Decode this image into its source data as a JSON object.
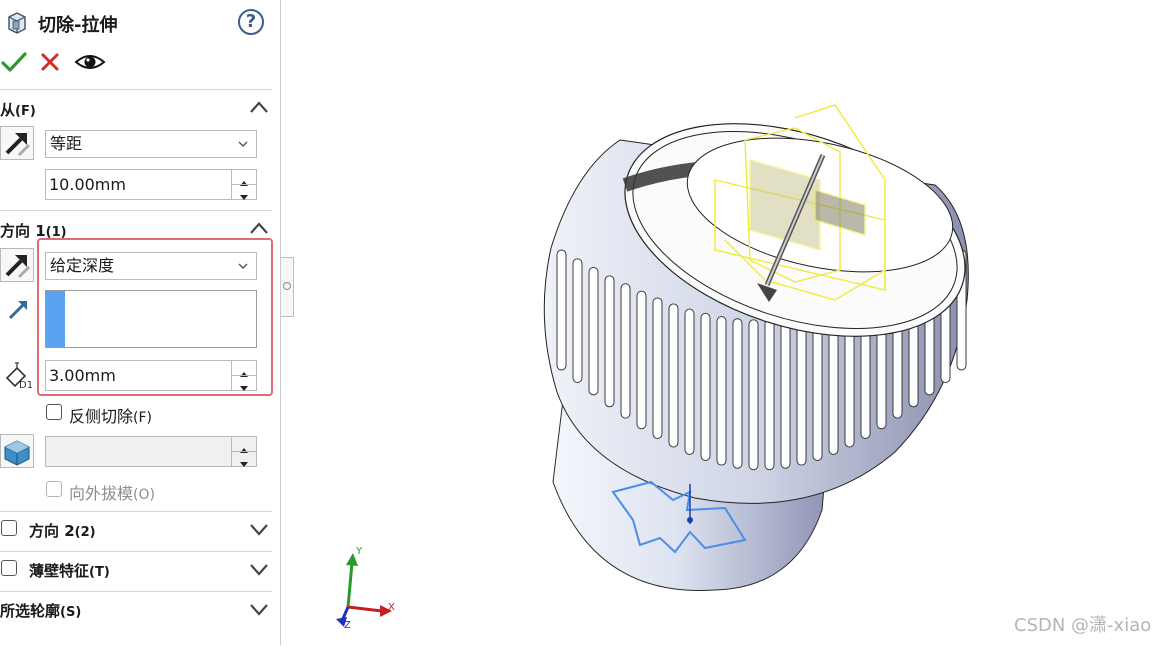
{
  "feature": {
    "title": "切除-拉伸",
    "help": "?"
  },
  "actions": {
    "ok": "check-icon",
    "cancel": "close-icon",
    "preview": "eye-icon"
  },
  "from": {
    "title": "从",
    "shortcut": "(F)",
    "type": "等距",
    "offset": "10.00mm"
  },
  "direction1": {
    "title": "方向 1",
    "shortcut": "(1)",
    "end_condition": "给定深度",
    "depth": "3.00mm",
    "depth_icon_label": "D1",
    "flip_side_label": "反侧切除",
    "flip_side_shortcut": "(F)",
    "flip_side_checked": false,
    "draft_value": "",
    "draft_outward_label": "向外拔模",
    "draft_outward_shortcut": "(O)"
  },
  "direction2": {
    "title": "方向 2",
    "shortcut": "(2)",
    "checked": false
  },
  "thin_feature": {
    "title": "薄壁特征",
    "shortcut": "(T)",
    "checked": false
  },
  "selected_contours": {
    "title": "所选轮廓",
    "shortcut": "(S)"
  },
  "triad": {
    "x": "X",
    "y": "Y",
    "z": "Z"
  },
  "watermark": "CSDN @潇-xiao",
  "colors": {
    "highlight_border": "#e06a78",
    "list_selection": "#5aa3f2",
    "ok_green": "#2e9a2e",
    "cancel_red": "#d42a2a",
    "preview_yellow": "#f0ea3a",
    "sketch_blue": "#4a8ee8"
  }
}
